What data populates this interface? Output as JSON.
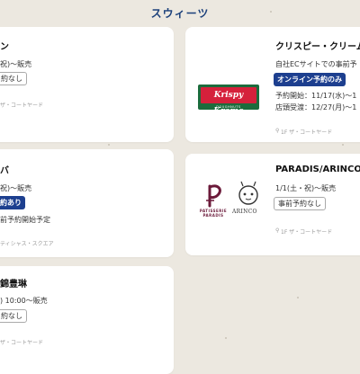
{
  "section": {
    "title": "スウィーツ"
  },
  "cards": [
    {
      "name": "ン",
      "date": "祝)〜販売",
      "badge": "約なし",
      "location": "ザ・コートヤード"
    },
    {
      "name": "クリスピー・クリーム",
      "info": "自社ECサイトでの事前予",
      "badge": "オンライン予約のみ",
      "line1": "予約開始：11/17(水)〜1",
      "line2": "店頭受渡：12/27(月)〜1",
      "location": "1F ザ・コートヤード",
      "logo_main": "Krispy Kreme",
      "logo_sub": "DOUGHNUTS"
    },
    {
      "name": "バ",
      "date": "祝)〜販売",
      "badge": "約あり",
      "info": "前予約開始予定",
      "location": "ティシャス・スクエア"
    },
    {
      "name": "PARADIS/ARINCO",
      "date": "1/1(土・祝)〜販売",
      "badge": "事前予約なし",
      "location": "1F ザ・コートヤード",
      "logo_paradis": "PATISSERIE PARADIS",
      "logo_arinco": "ARINCO"
    },
    {
      "name": "錦豊琳",
      "date": ") 10:00〜販売",
      "badge": "約なし",
      "location": "ザ・コートヤード"
    }
  ],
  "colors": {
    "navy": "#1d3f8f",
    "title": "#1a3f7a",
    "background": "#ece8e0"
  },
  "icons": {
    "location": "location-pin-icon"
  }
}
